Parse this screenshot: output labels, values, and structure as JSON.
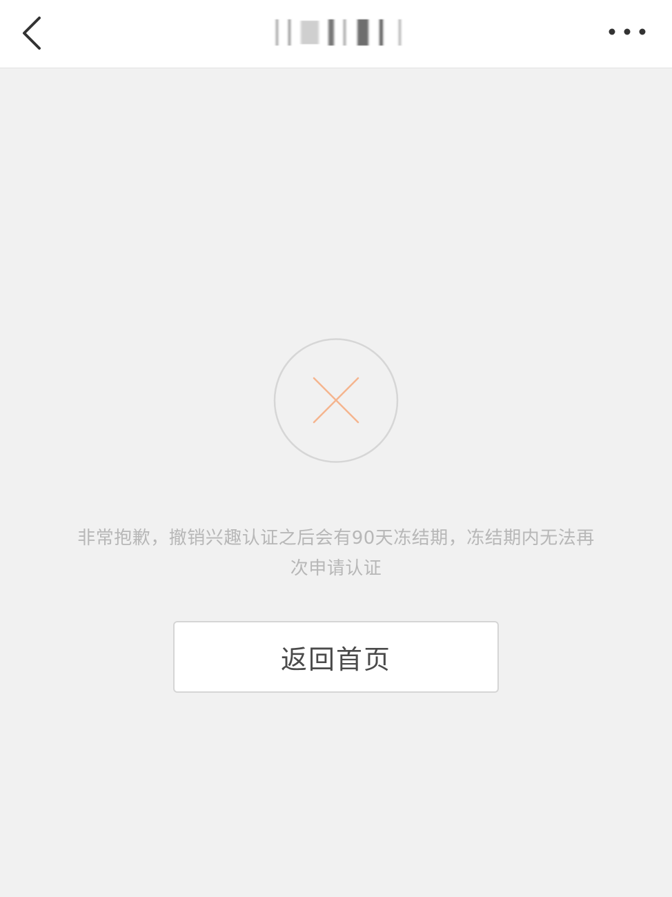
{
  "header": {
    "back_icon": "chevron-left-icon",
    "more_icon": "ellipsis-icon"
  },
  "status": {
    "icon": "close-x-icon",
    "accent_color": "#f5b48e",
    "message": "非常抱歉，撤销兴趣认证之后会有90天冻结期，冻结期内无法再次申请认证"
  },
  "actions": {
    "home_label": "返回首页"
  }
}
